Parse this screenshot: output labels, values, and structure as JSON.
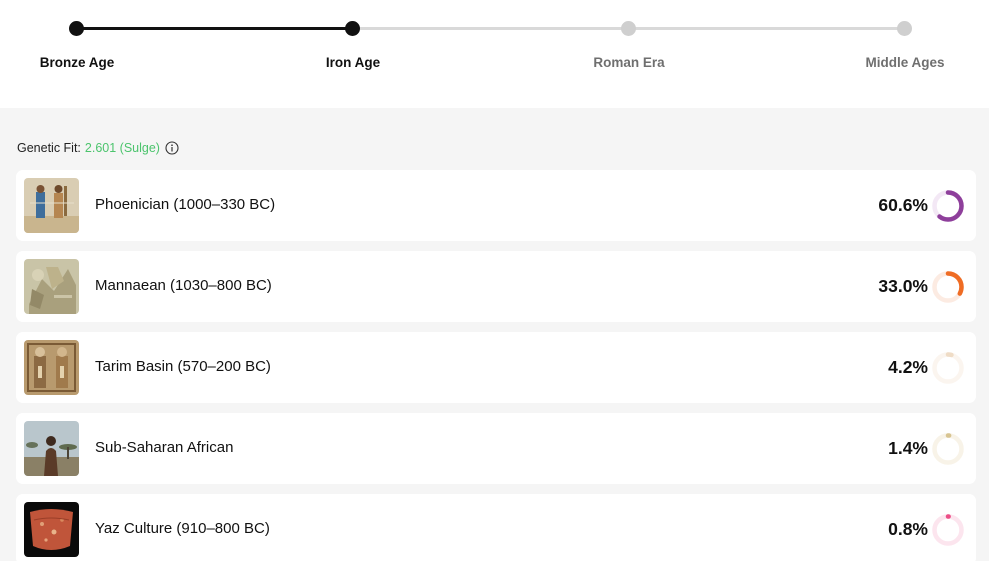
{
  "timeline": {
    "stops": [
      {
        "label": "Bronze Age",
        "active": true
      },
      {
        "label": "Iron Age",
        "active": true
      },
      {
        "label": "Roman Era",
        "active": false
      },
      {
        "label": "Middle Ages",
        "active": false
      }
    ]
  },
  "genetic_fit": {
    "label": "Genetic Fit:",
    "value": "2.601 (Sulge)",
    "value_color": "#4cc46d",
    "info_icon": "info-icon"
  },
  "populations": [
    {
      "name": "Phoenician (1000–330 BC)",
      "percent_text": "60.6%",
      "fraction": 0.606,
      "color": "#8e3f9b",
      "track_color": "#f3e8f5"
    },
    {
      "name": "Mannaean (1030–800 BC)",
      "percent_text": "33.0%",
      "fraction": 0.33,
      "color": "#ef6c24",
      "track_color": "#fcebe2"
    },
    {
      "name": "Tarim Basin (570–200 BC)",
      "percent_text": "4.2%",
      "fraction": 0.042,
      "color": "#efdcc6",
      "track_color": "#fbf5ef"
    },
    {
      "name": "Sub-Saharan African",
      "percent_text": "1.4%",
      "fraction": 0.014,
      "color": "#d8c491",
      "track_color": "#f8f3e8"
    },
    {
      "name": "Yaz Culture (910–800 BC)",
      "percent_text": "0.8%",
      "fraction": 0.008,
      "color": "#ec4d86",
      "track_color": "#fce5ee"
    }
  ]
}
